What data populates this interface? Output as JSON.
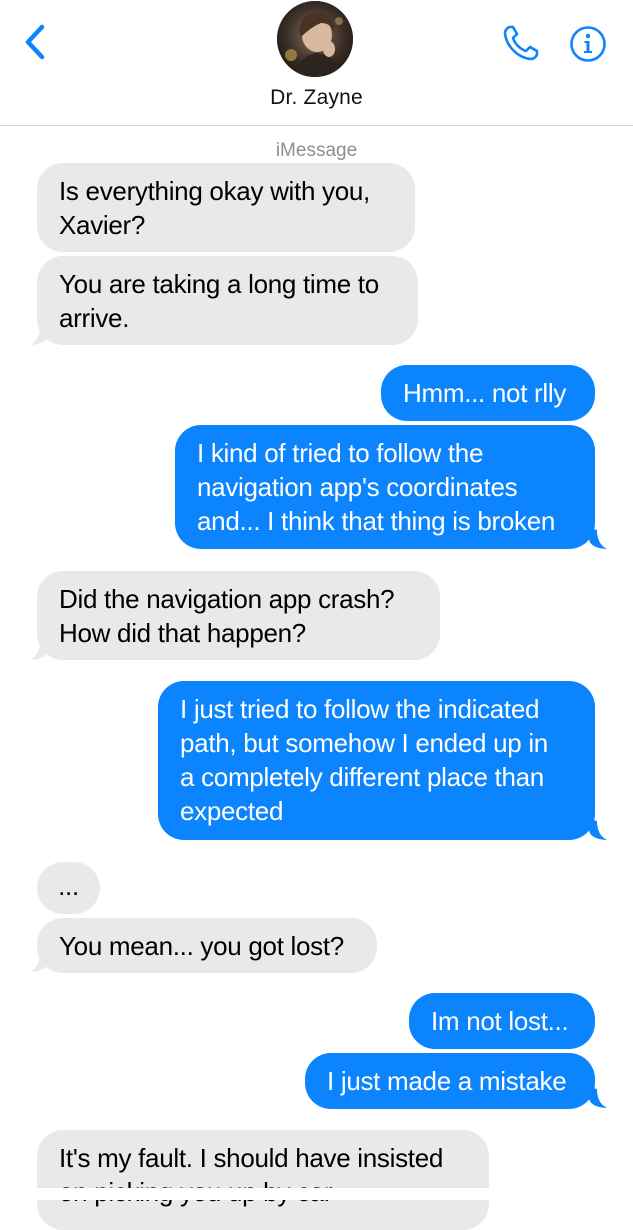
{
  "header": {
    "back_icon": "chevron-left-icon",
    "contact_name": "Dr. Zayne",
    "phone_icon": "phone-icon",
    "info_icon": "info-icon",
    "accent_color": "#0b84fe"
  },
  "service_label": "iMessage",
  "messages": [
    {
      "direction": "incoming",
      "lines": [
        "Is everything okay with you,",
        "Xavier?"
      ]
    },
    {
      "direction": "incoming",
      "lines": [
        "You are taking a long time to",
        "arrive."
      ]
    },
    {
      "direction": "outgoing",
      "lines": [
        "Hmm... not rlly"
      ]
    },
    {
      "direction": "outgoing",
      "lines": [
        "I kind of tried to follow the",
        "navigation app's coordinates",
        "and... I think that thing is broken"
      ]
    },
    {
      "direction": "incoming",
      "lines": [
        "Did the navigation app crash?",
        "How did that happen?"
      ]
    },
    {
      "direction": "outgoing",
      "lines": [
        "I just tried to follow the indicated",
        "path, but somehow I ended up in",
        "a completely different place than",
        "expected"
      ]
    },
    {
      "direction": "incoming",
      "lines": [
        "..."
      ]
    },
    {
      "direction": "incoming",
      "lines": [
        "You mean... you got lost?"
      ]
    },
    {
      "direction": "outgoing",
      "lines": [
        "Im not lost..."
      ]
    },
    {
      "direction": "outgoing",
      "lines": [
        "I just made a mistake"
      ]
    },
    {
      "direction": "incoming",
      "lines": [
        "It's my fault. I should have insisted",
        "on picking you up by car"
      ]
    }
  ],
  "colors": {
    "incoming_bubble": "#e9e9eb",
    "outgoing_bubble": "#0b84fe",
    "service_label": "#8e8e93"
  }
}
